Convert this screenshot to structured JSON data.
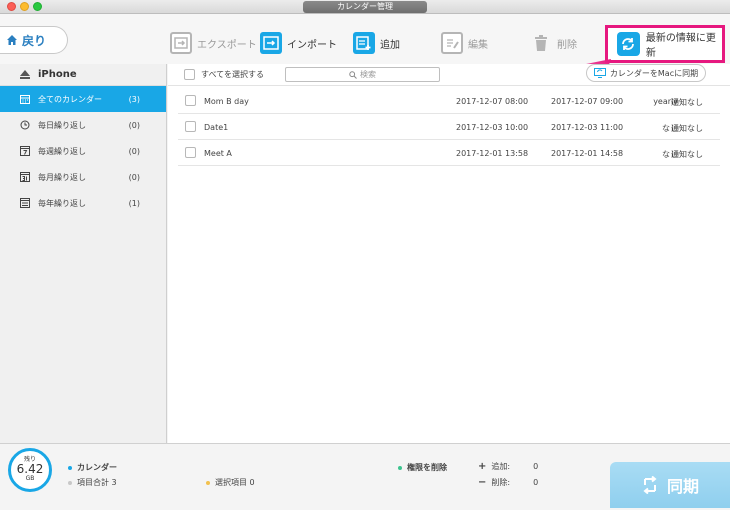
{
  "window": {
    "title": "カレンダー管理"
  },
  "toolbar": {
    "back_label": "戻り",
    "export_label": "エクスポート",
    "import_label": "インポート",
    "add_label": "追加",
    "edit_label": "編集",
    "delete_label": "削除",
    "refresh_label": "最新の情報に更新"
  },
  "sidebar": {
    "device": "iPhone",
    "items": [
      {
        "label": "全てのカレンダー",
        "count": "(3)",
        "icon": "calendar-all-icon"
      },
      {
        "label": "毎日繰り返し",
        "count": "(0)",
        "icon": "clock-repeat-icon"
      },
      {
        "label": "毎週繰り返し",
        "count": "(0)",
        "icon": "calendar-7-icon"
      },
      {
        "label": "毎月繰り返し",
        "count": "(0)",
        "icon": "calendar-31-icon"
      },
      {
        "label": "毎年繰り返し",
        "count": "(1)",
        "icon": "calendar-365-icon"
      }
    ]
  },
  "list": {
    "select_all_label": "すべてを選択する",
    "search_placeholder": "検索",
    "sync_mac_label": "カレンダーをMacに同期",
    "rows": [
      {
        "title": "Mom  B day",
        "start": "2017-12-07 08:00",
        "end": "2017-12-07 09:00",
        "repeat": "yearly",
        "alarm": "通知なし"
      },
      {
        "title": "Date1",
        "start": "2017-12-03 10:00",
        "end": "2017-12-03 11:00",
        "repeat": "なし",
        "alarm": "通知なし"
      },
      {
        "title": "Meet A",
        "start": "2017-12-01 13:58",
        "end": "2017-12-01 14:58",
        "repeat": "なし",
        "alarm": "通知なし"
      }
    ]
  },
  "footer": {
    "storage_label": "残り",
    "storage_value": "6.42",
    "storage_unit": "GB",
    "calendar_label": "カレンダー",
    "total_label": "項目合計 3",
    "selected_label": "選択項目 0",
    "remove_perm_label": "権限を削除",
    "add_label": "追加:",
    "add_value": "0",
    "delete_label": "削除:",
    "delete_value": "0",
    "sync_label": "同期"
  },
  "colors": {
    "accent": "#19a7e6",
    "highlight": "#e6187f"
  }
}
